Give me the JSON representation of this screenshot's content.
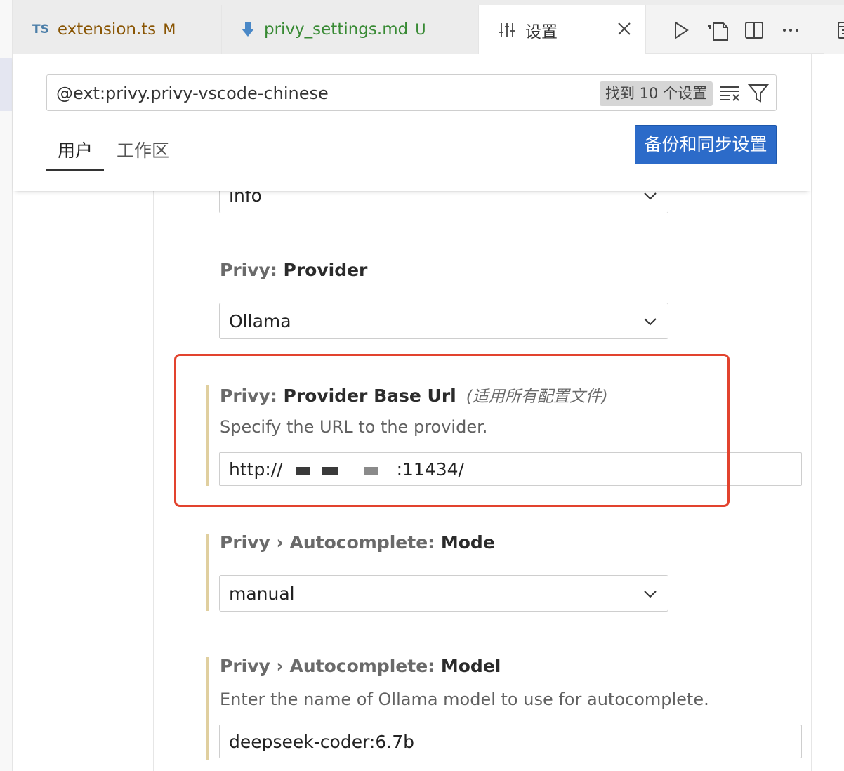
{
  "tabs": [
    {
      "badge": "TS",
      "label": "extension.ts",
      "status": "M"
    },
    {
      "label": "privy_settings.md",
      "status": "U"
    },
    {
      "label": "设置"
    }
  ],
  "toolbar_icons": [
    "run-icon",
    "open-file-icon",
    "split-editor-icon",
    "more-actions-icon"
  ],
  "search": {
    "value": "@ext:privy.privy-vscode-chinese",
    "result_count": "找到 10 个设置"
  },
  "scopes": {
    "user": "用户",
    "workspace": "工作区"
  },
  "sync_button": "备份和同步设置",
  "settings": {
    "log_level_value": "info",
    "provider": {
      "category": "Privy: ",
      "name": "Provider",
      "value": "Ollama"
    },
    "base_url": {
      "category": "Privy: ",
      "name": "Provider Base Url",
      "scope_note": "(适用所有配置文件)",
      "description": "Specify the URL to the provider.",
      "value_prefix": "http://",
      "value_suffix": ":11434/"
    },
    "autocomplete_mode": {
      "category": "Privy › Autocomplete: ",
      "name": "Mode",
      "value": "manual"
    },
    "autocomplete_model": {
      "category": "Privy › Autocomplete: ",
      "name": "Model",
      "description": "Enter the name of Ollama model to use for autocomplete.",
      "value": "deepseek-coder:6.7b"
    }
  },
  "colors": {
    "accent": "#2c6bc9",
    "highlight_frame": "#e2432e",
    "modified_bar": "#e0cf9f"
  }
}
